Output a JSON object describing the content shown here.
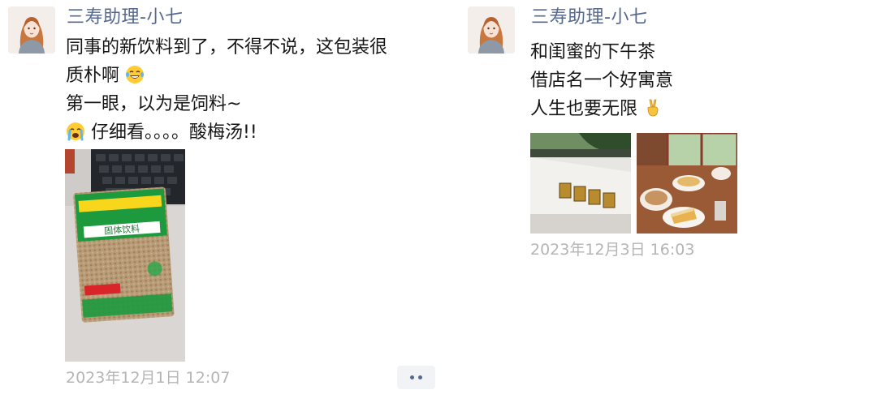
{
  "posts": [
    {
      "author": "三寿助理-小七",
      "avatar_icon": "avatar-illustrated-woman",
      "lines": [
        {
          "text": "同事的新饮料到了，不得不说，这包装很"
        },
        {
          "text": "质朴啊",
          "emoji_after": "laughing-tears-emoji"
        },
        {
          "text": "第一眼，以为是饲料~"
        },
        {
          "emoji_before": "crying-emoji",
          "text": "仔细看。。。。酸梅汤!!"
        }
      ],
      "photos": [
        {
          "subject": "drink-packet-photo",
          "label": "固体饮料"
        }
      ],
      "timestamp": "2023年12月1日 12:07",
      "more_icon": "more-dots-icon"
    },
    {
      "author": "三寿助理-小七",
      "avatar_icon": "avatar-illustrated-woman",
      "lines": [
        {
          "text": "和闺蜜的下午茶"
        },
        {
          "text": "借店名一个好寓意"
        },
        {
          "text": "人生也要无限",
          "emoji_after": "victory-hand-emoji"
        }
      ],
      "photos": [
        {
          "subject": "storefront-sign-photo"
        },
        {
          "subject": "afternoon-tea-photo"
        }
      ],
      "timestamp": "2023年12月3日 16:03"
    }
  ],
  "colors": {
    "author_name": "#56688f",
    "timestamp": "#b5b5b5",
    "body_text": "#161616",
    "more_button_bg": "#f2f3f6"
  }
}
